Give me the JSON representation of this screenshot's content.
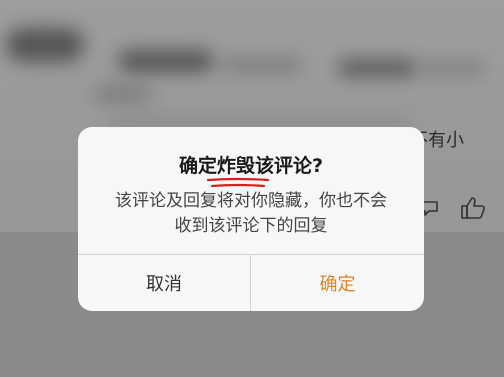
{
  "background": {
    "partial_text_right": "不有小"
  },
  "dialog": {
    "title": "确定炸毁该评论?",
    "message_line1": "该评论及回复将对你隐藏，你也不会",
    "message_line2": "收到该评论下的回复",
    "cancel_label": "取消",
    "confirm_label": "确定"
  },
  "colors": {
    "confirm_accent": "#d9862c",
    "annotation_underline": "#d82020",
    "dialog_background": "#f7f7f7",
    "overlay": "#8f8f8f"
  },
  "icons": [
    "thumbs-up-icon",
    "reply-icon"
  ]
}
